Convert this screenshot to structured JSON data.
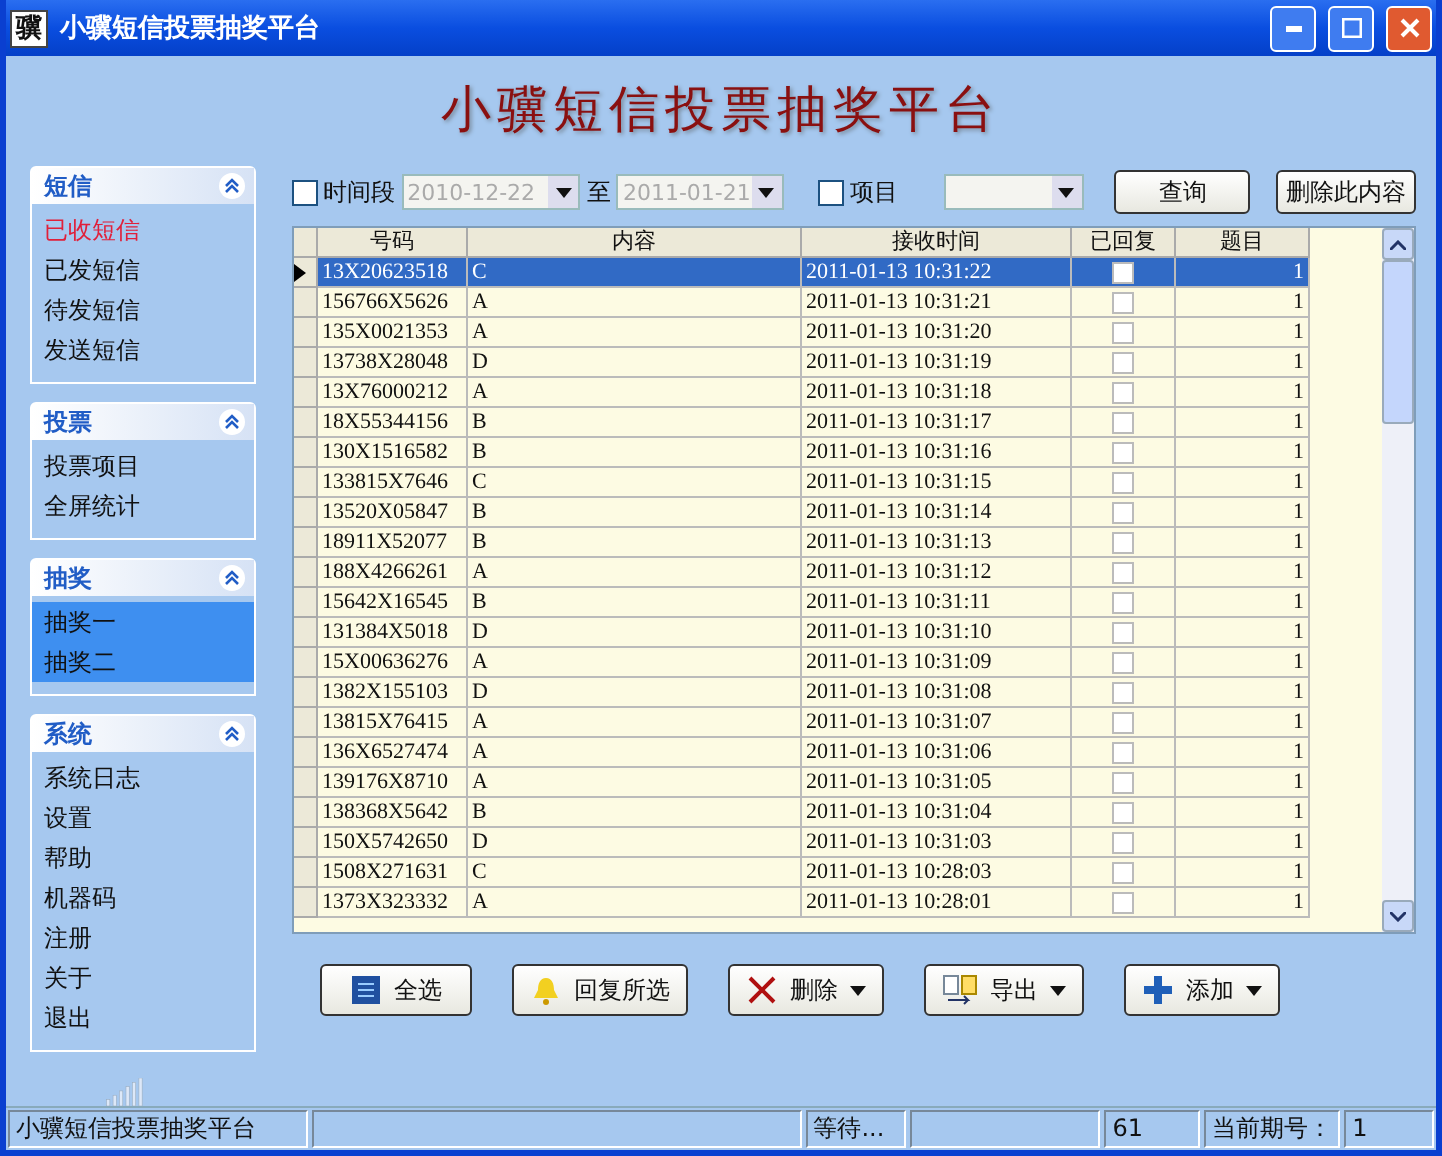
{
  "window": {
    "icon_glyph": "骥",
    "title": "小骥短信投票抽奖平台"
  },
  "banner": "小骥短信投票抽奖平台",
  "sidebar": {
    "groups": [
      {
        "title": "短信",
        "expanded": true,
        "items": [
          {
            "label": "已收短信",
            "selected": false,
            "current": true
          },
          {
            "label": "已发短信",
            "selected": false,
            "current": false
          },
          {
            "label": "待发短信",
            "selected": false,
            "current": false
          },
          {
            "label": "发送短信",
            "selected": false,
            "current": false
          }
        ]
      },
      {
        "title": "投票",
        "expanded": true,
        "items": [
          {
            "label": "投票项目",
            "selected": false,
            "current": false
          },
          {
            "label": "全屏统计",
            "selected": false,
            "current": false
          }
        ]
      },
      {
        "title": "抽奖",
        "expanded": true,
        "items": [
          {
            "label": "抽奖一",
            "selected": true,
            "current": false
          },
          {
            "label": "抽奖二",
            "selected": true,
            "current": false
          }
        ]
      },
      {
        "title": "系统",
        "expanded": true,
        "items": [
          {
            "label": "系统日志",
            "selected": false,
            "current": false
          },
          {
            "label": "设置",
            "selected": false,
            "current": false
          },
          {
            "label": "帮助",
            "selected": false,
            "current": false
          },
          {
            "label": "机器码",
            "selected": false,
            "current": false
          },
          {
            "label": "注册",
            "selected": false,
            "current": false
          },
          {
            "label": "关于",
            "selected": false,
            "current": false
          },
          {
            "label": "退出",
            "selected": false,
            "current": false
          }
        ]
      }
    ]
  },
  "filter": {
    "time_range": {
      "label": "时间段",
      "checked": false,
      "from": "2010-12-22",
      "to_label": "至",
      "to": "2011-01-21"
    },
    "project": {
      "label": "项目",
      "checked": false
    },
    "buttons": [
      "查询",
      "删除此内容"
    ]
  },
  "table": {
    "columns": [
      "号码",
      "内容",
      "接收时间",
      "已回复",
      "题目"
    ],
    "rows": [
      {
        "number": "13X20623518",
        "content": "C",
        "time": "2011-01-13 10:31:22",
        "replied": false,
        "topic": "1",
        "selected": true
      },
      {
        "number": "156766X5626",
        "content": "A",
        "time": "2011-01-13 10:31:21",
        "replied": false,
        "topic": "1",
        "selected": false
      },
      {
        "number": "135X0021353",
        "content": "A",
        "time": "2011-01-13 10:31:20",
        "replied": false,
        "topic": "1",
        "selected": false
      },
      {
        "number": "13738X28048",
        "content": "D",
        "time": "2011-01-13 10:31:19",
        "replied": false,
        "topic": "1",
        "selected": false
      },
      {
        "number": "13X76000212",
        "content": "A",
        "time": "2011-01-13 10:31:18",
        "replied": false,
        "topic": "1",
        "selected": false
      },
      {
        "number": "18X55344156",
        "content": "B",
        "time": "2011-01-13 10:31:17",
        "replied": false,
        "topic": "1",
        "selected": false
      },
      {
        "number": "130X1516582",
        "content": "B",
        "time": "2011-01-13 10:31:16",
        "replied": false,
        "topic": "1",
        "selected": false
      },
      {
        "number": "133815X7646",
        "content": "C",
        "time": "2011-01-13 10:31:15",
        "replied": false,
        "topic": "1",
        "selected": false
      },
      {
        "number": "13520X05847",
        "content": "B",
        "time": "2011-01-13 10:31:14",
        "replied": false,
        "topic": "1",
        "selected": false
      },
      {
        "number": "18911X52077",
        "content": "B",
        "time": "2011-01-13 10:31:13",
        "replied": false,
        "topic": "1",
        "selected": false
      },
      {
        "number": "188X4266261",
        "content": "A",
        "time": "2011-01-13 10:31:12",
        "replied": false,
        "topic": "1",
        "selected": false
      },
      {
        "number": "15642X16545",
        "content": "B",
        "time": "2011-01-13 10:31:11",
        "replied": false,
        "topic": "1",
        "selected": false
      },
      {
        "number": "131384X5018",
        "content": "D",
        "time": "2011-01-13 10:31:10",
        "replied": false,
        "topic": "1",
        "selected": false
      },
      {
        "number": "15X00636276",
        "content": "A",
        "time": "2011-01-13 10:31:09",
        "replied": false,
        "topic": "1",
        "selected": false
      },
      {
        "number": "1382X155103",
        "content": "D",
        "time": "2011-01-13 10:31:08",
        "replied": false,
        "topic": "1",
        "selected": false
      },
      {
        "number": "13815X76415",
        "content": "A",
        "time": "2011-01-13 10:31:07",
        "replied": false,
        "topic": "1",
        "selected": false
      },
      {
        "number": "136X6527474",
        "content": "A",
        "time": "2011-01-13 10:31:06",
        "replied": false,
        "topic": "1",
        "selected": false
      },
      {
        "number": "139176X8710",
        "content": "A",
        "time": "2011-01-13 10:31:05",
        "replied": false,
        "topic": "1",
        "selected": false
      },
      {
        "number": "138368X5642",
        "content": "B",
        "time": "2011-01-13 10:31:04",
        "replied": false,
        "topic": "1",
        "selected": false
      },
      {
        "number": "150X5742650",
        "content": "D",
        "time": "2011-01-13 10:31:03",
        "replied": false,
        "topic": "1",
        "selected": false
      },
      {
        "number": "1508X271631",
        "content": "C",
        "time": "2011-01-13 10:28:03",
        "replied": false,
        "topic": "1",
        "selected": false
      },
      {
        "number": "1373X323332",
        "content": "A",
        "time": "2011-01-13 10:28:01",
        "replied": false,
        "topic": "1",
        "selected": false
      }
    ]
  },
  "actions": [
    {
      "kind": "list",
      "label": "全选",
      "dropdown": false
    },
    {
      "kind": "bell",
      "label": "回复所选",
      "dropdown": false
    },
    {
      "kind": "cross",
      "label": "删除",
      "dropdown": true
    },
    {
      "kind": "export",
      "label": "导出",
      "dropdown": true
    },
    {
      "kind": "plus",
      "label": "添加",
      "dropdown": true
    }
  ],
  "status_bar": {
    "app": "小骥短信投票抽奖平台",
    "state": "等待...",
    "count": "61",
    "period_label": "当前期号：",
    "period": "1"
  }
}
